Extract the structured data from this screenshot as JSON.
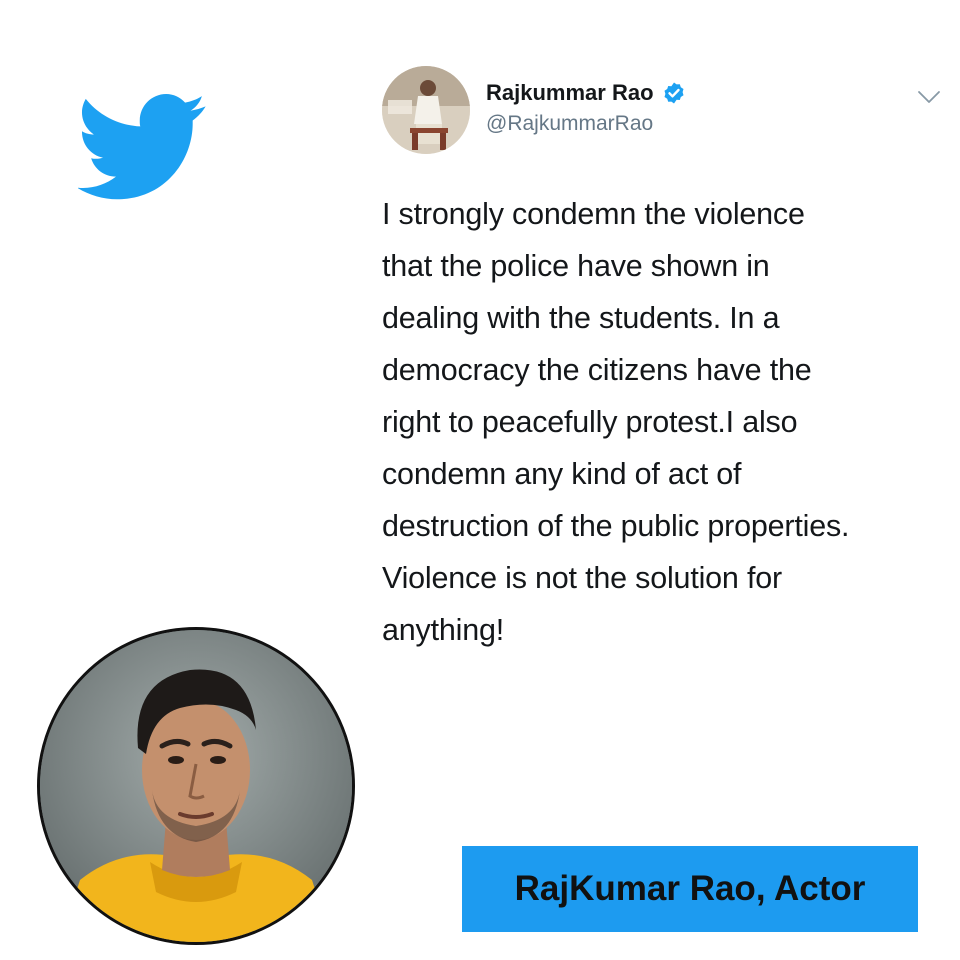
{
  "logo": {
    "icon": "twitter-bird-icon",
    "color": "#1da1f2"
  },
  "tweet": {
    "author_name": "Rajkummar Rao",
    "handle": "@RajkummarRao",
    "verified": true,
    "badge_color": "#1da1f2",
    "lines": [
      "I strongly condemn the violence",
      "that the police have shown in",
      "dealing with the students. In a",
      "democracy the citizens have the",
      "right to peacefully protest.I also",
      "condemn any kind of act of",
      "destruction of the public properties.",
      "Violence is not the solution for",
      "anything!"
    ]
  },
  "caption": {
    "text": "RajKumar Rao, Actor",
    "background": "#1d9bf0"
  }
}
